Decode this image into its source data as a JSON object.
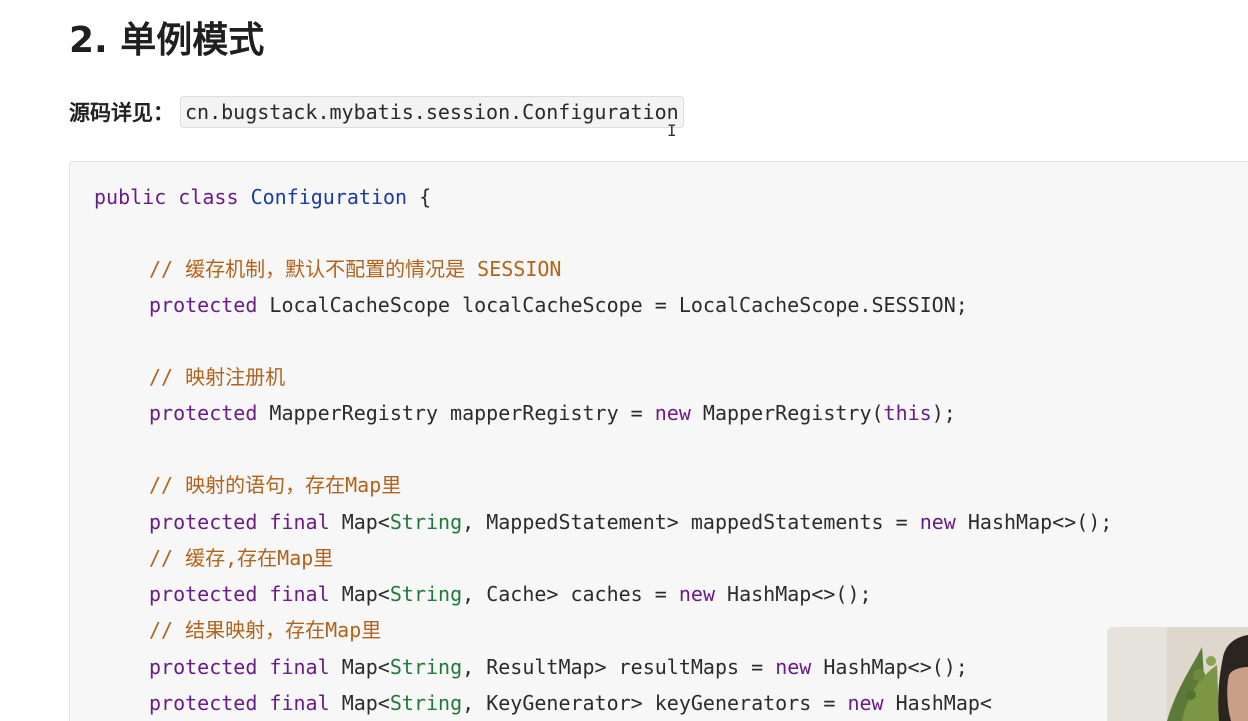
{
  "heading": "2. 单例模式",
  "source": {
    "label": "源码详见：",
    "path": "cn.bugstack.mybatis.session.Configuration"
  },
  "code": {
    "l1": {
      "kw1": "public",
      "kw2": "class",
      "cls": "Configuration",
      "rest": "{"
    },
    "l2": {
      "comment": "// 缓存机制，默认不配置的情况是 SESSION"
    },
    "l3": {
      "kw": "protected",
      "rest": "LocalCacheScope localCacheScope = LocalCacheScope.SESSION;"
    },
    "l4": {
      "comment": "// 映射注册机"
    },
    "l5": {
      "kw": "protected",
      "mid": "MapperRegistry mapperRegistry =",
      "kw_new": "new",
      "call": "MapperRegistry(",
      "kw_this": "this",
      "tail": ");"
    },
    "l6": {
      "comment": "// 映射的语句，存在Map里"
    },
    "l7": {
      "kw": "protected",
      "kw_final": "final",
      "map": "Map<",
      "str": "String",
      "rest": ", MappedStatement> mappedStatements =",
      "kw_new": "new",
      "tail": "HashMap<>();"
    },
    "l8": {
      "comment": "// 缓存,存在Map里"
    },
    "l9": {
      "kw": "protected",
      "kw_final": "final",
      "map": "Map<",
      "str": "String",
      "rest": ", Cache> caches =",
      "kw_new": "new",
      "tail": "HashMap<>();"
    },
    "l10": {
      "comment": "// 结果映射，存在Map里"
    },
    "l11": {
      "kw": "protected",
      "kw_final": "final",
      "map": "Map<",
      "str": "String",
      "rest": ", ResultMap> resultMaps =",
      "kw_new": "new",
      "tail": "HashMap<>();"
    },
    "l12": {
      "kw": "protected",
      "kw_final": "final",
      "map": "Map<",
      "str": "String",
      "rest": ", KeyGenerator> keyGenerators =",
      "kw_new": "new",
      "tail": "HashMap<"
    }
  },
  "colors": {
    "keyword": "#6a1b8a",
    "class_name": "#1a3aa8",
    "comment": "#b3621a",
    "string_type": "#1f7a3a",
    "code_background": "#f7f7f7"
  }
}
